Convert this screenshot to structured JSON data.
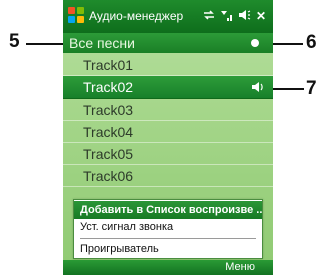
{
  "title_bar": {
    "title": "Аудио-менеджер",
    "icons": [
      "windows-logo-icon",
      "sync-icon",
      "signal-icon",
      "speaker-volume-icon",
      "close-icon"
    ],
    "close_glyph": "✕"
  },
  "header": {
    "label": "Все песни"
  },
  "tracks": [
    {
      "label": "Track01",
      "selected": false
    },
    {
      "label": "Track02",
      "selected": true,
      "icon": "speaker-icon"
    },
    {
      "label": "Track03",
      "selected": false
    },
    {
      "label": "Track04",
      "selected": false
    },
    {
      "label": "Track05",
      "selected": false
    },
    {
      "label": "Track06",
      "selected": false
    }
  ],
  "context_menu": {
    "items": [
      {
        "label": "Добавить в Список воспроизве ...",
        "selected": true
      },
      {
        "label": "Уст. сигнал звонка",
        "selected": false
      },
      {
        "label": "Проигрыватель",
        "selected": false
      }
    ]
  },
  "softkeys": {
    "right": "Меню"
  },
  "callouts": {
    "c5": "5",
    "c6": "6",
    "c7": "7"
  },
  "colors": {
    "title_bar": "#0e6e1c",
    "list_background": "#a5d68a",
    "selection": "#1a7f26",
    "menu_background": "#ffffff"
  }
}
